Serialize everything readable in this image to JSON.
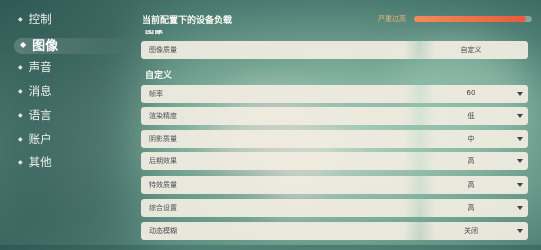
{
  "sidebar": {
    "items": [
      {
        "label": "控制"
      },
      {
        "label": "图像"
      },
      {
        "label": "声音"
      },
      {
        "label": "消息"
      },
      {
        "label": "语言"
      },
      {
        "label": "账户"
      },
      {
        "label": "其他"
      }
    ],
    "active_index": 1
  },
  "load": {
    "title": "当前配置下的设备负载",
    "status": "严重过高",
    "level_fraction": 0.95,
    "accent": "#ea5a3a"
  },
  "sections": {
    "image_title": "图像",
    "custom_title": "自定义"
  },
  "settings": {
    "image_quality": {
      "label": "图像质量",
      "value": "自定义"
    },
    "custom": [
      {
        "label": "帧率",
        "value": "60"
      },
      {
        "label": "渲染精度",
        "value": "低"
      },
      {
        "label": "阴影质量",
        "value": "中"
      },
      {
        "label": "后期效果",
        "value": "高"
      },
      {
        "label": "特效质量",
        "value": "高"
      },
      {
        "label": "综合设置",
        "value": "高"
      },
      {
        "label": "动态模糊",
        "value": "关闭"
      }
    ]
  },
  "icons": {
    "dropdown": "chevron-down-icon",
    "bullet": "diamond-bullet-icon"
  }
}
